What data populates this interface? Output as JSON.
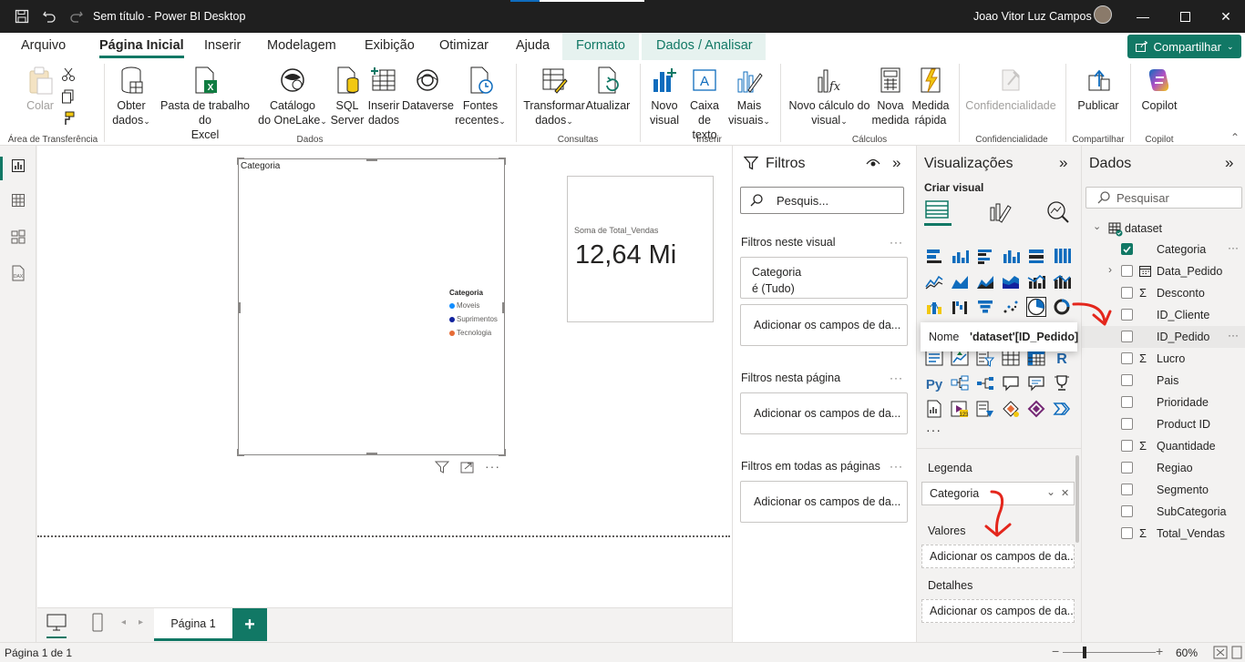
{
  "titlebar": {
    "title": "Sem título - Power BI Desktop",
    "user": "Joao Vitor Luz Campos"
  },
  "menu": {
    "tabs": [
      "Arquivo",
      "Página Inicial",
      "Inserir",
      "Modelagem",
      "Exibição",
      "Otimizar",
      "Ajuda",
      "Formato",
      "Dados / Analisar"
    ],
    "share": "Compartilhar"
  },
  "ribbon": {
    "colar": "Colar",
    "obter": [
      "Obter",
      "dados"
    ],
    "pasta": [
      "Pasta de trabalho do",
      "Excel"
    ],
    "catalogo": [
      "Catálogo",
      "do OneLake"
    ],
    "sql": [
      "SQL",
      "Server"
    ],
    "inserir_dados": [
      "Inserir",
      "dados"
    ],
    "dataverse": "Dataverse",
    "fontes": [
      "Fontes",
      "recentes"
    ],
    "transformar": [
      "Transformar",
      "dados"
    ],
    "atualizar": "Atualizar",
    "novo_visual": [
      "Novo",
      "visual"
    ],
    "caixa": [
      "Caixa de",
      "texto"
    ],
    "mais": [
      "Mais",
      "visuais"
    ],
    "novo_calc": [
      "Novo cálculo do",
      "visual"
    ],
    "nova_medida": [
      "Nova",
      "medida"
    ],
    "medida_rapida": [
      "Medida",
      "rápida"
    ],
    "confid": "Confidencialidade",
    "publicar": "Publicar",
    "copilot": "Copilot",
    "groups": {
      "area": "Área de Transferência",
      "dados": "Dados",
      "consultas": "Consultas",
      "inserir": "Inserir",
      "calculos": "Cálculos",
      "confid": "Confidencialidade",
      "compartilhar": "Compartilhar",
      "copilot": "Copilot"
    }
  },
  "canvas": {
    "pie": {
      "title": "Categoria",
      "legend_title": "Categoria",
      "legend": [
        {
          "label": "Moveis",
          "color": "#118DFF"
        },
        {
          "label": "Suprimentos",
          "color": "#12239E"
        },
        {
          "label": "Tecnologia",
          "color": "#E66C37"
        }
      ]
    },
    "card": {
      "label": "Soma de Total_Vendas",
      "value": "12,64 Mi"
    }
  },
  "pages": {
    "tab": "Página 1",
    "add": "+"
  },
  "status": {
    "page": "Página 1 de 1",
    "zoom": "60%"
  },
  "filters": {
    "title": "Filtros",
    "search": "Pesquis...",
    "visual_label": "Filtros neste visual",
    "visual_filter": [
      "Categoria",
      "é (Tudo)"
    ],
    "add": "Adicionar os campos de da...",
    "page_label": "Filtros nesta página",
    "all_label": "Filtros em todas as páginas"
  },
  "viz": {
    "title": "Visualizações",
    "criar": "Criar visual",
    "legenda": "Legenda",
    "legenda_value": "Categoria",
    "valores": "Valores",
    "detalhes": "Detalhes",
    "add": "Adicionar os campos de da...",
    "tooltip_name": "Nome",
    "tooltip_value": "'dataset'[ID_Pedido]",
    "py": "Py",
    "r": "R"
  },
  "data": {
    "title": "Dados",
    "search": "Pesquisar",
    "table": "dataset",
    "fields": [
      {
        "name": "Categoria",
        "checked": true,
        "sigma": false,
        "more": true
      },
      {
        "name": "Data_Pedido",
        "checked": false,
        "sigma": false,
        "date": true,
        "expand": true
      },
      {
        "name": "Desconto",
        "checked": false,
        "sigma": true
      },
      {
        "name": "ID_Cliente",
        "checked": false,
        "sigma": false
      },
      {
        "name": "ID_Pedido",
        "checked": false,
        "sigma": false,
        "more": true,
        "hover": true
      },
      {
        "name": "Lucro",
        "checked": false,
        "sigma": true
      },
      {
        "name": "Pais",
        "checked": false,
        "sigma": false
      },
      {
        "name": "Prioridade",
        "checked": false,
        "sigma": false
      },
      {
        "name": "Product ID",
        "checked": false,
        "sigma": false
      },
      {
        "name": "Quantidade",
        "checked": false,
        "sigma": true
      },
      {
        "name": "Regiao",
        "checked": false,
        "sigma": false
      },
      {
        "name": "Segmento",
        "checked": false,
        "sigma": false
      },
      {
        "name": "SubCategoria",
        "checked": false,
        "sigma": false
      },
      {
        "name": "Total_Vendas",
        "checked": false,
        "sigma": true
      }
    ]
  }
}
